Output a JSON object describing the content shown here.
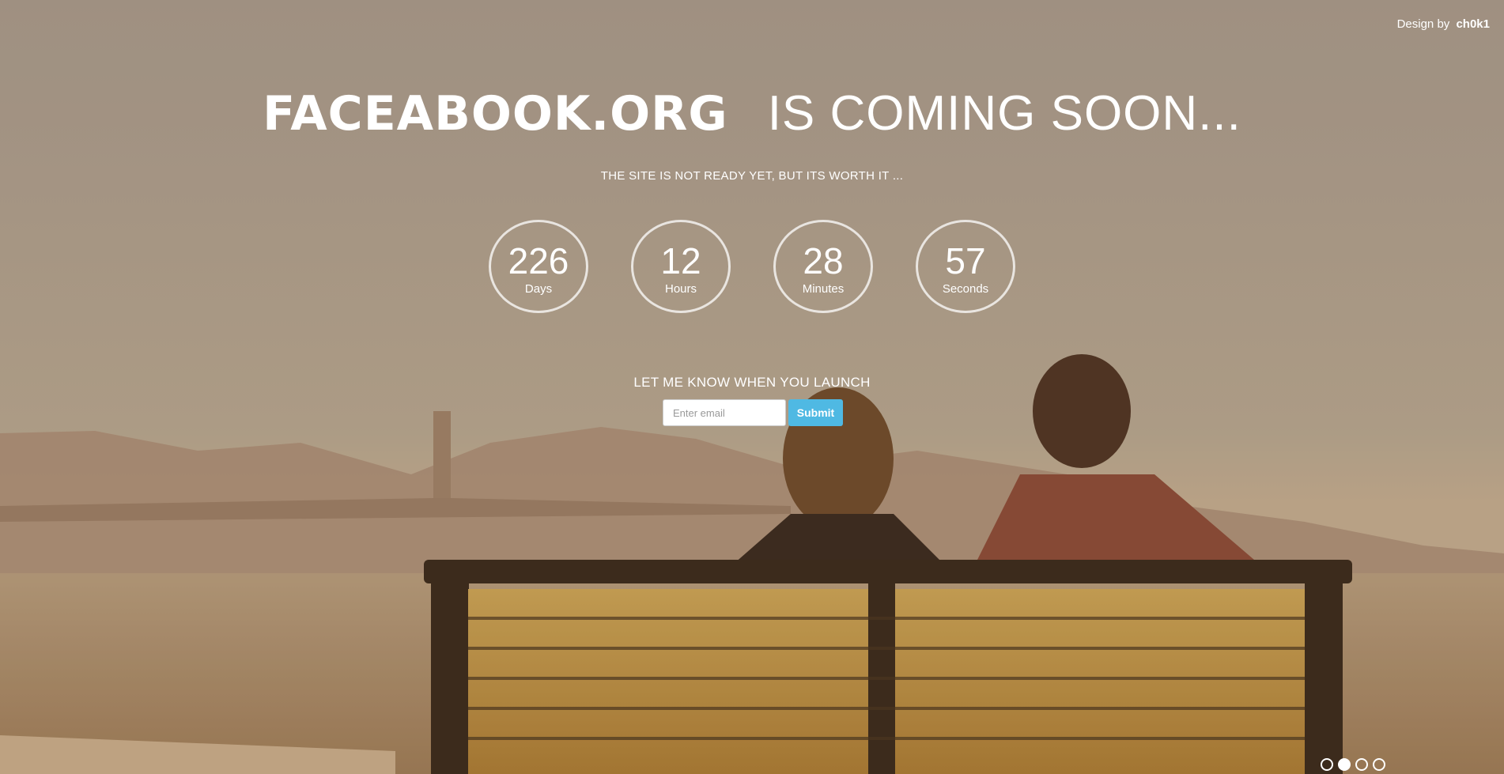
{
  "credit": {
    "prefix": "Design by",
    "author": "ch0k1"
  },
  "headline": {
    "brand": "FACEABOOK.ORG",
    "rest": "IS COMING SOON..."
  },
  "subline": "THE SITE IS NOT READY YET, BUT ITS WORTH IT ...",
  "countdown": [
    {
      "value": "226",
      "label": "Days"
    },
    {
      "value": "12",
      "label": "Hours"
    },
    {
      "value": "28",
      "label": "Minutes"
    },
    {
      "value": "57",
      "label": "Seconds"
    }
  ],
  "notify": {
    "label": "LET ME KNOW WHEN YOU LAUNCH",
    "email_placeholder": "Enter email",
    "submit_label": "Submit"
  },
  "slider": {
    "count": 4,
    "active_index": 1
  },
  "colors": {
    "accent": "#4fb9e3",
    "text": "#ffffff"
  }
}
